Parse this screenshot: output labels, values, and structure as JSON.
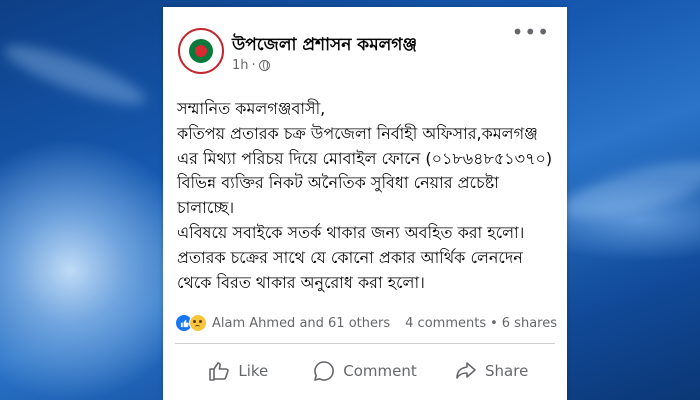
{
  "post": {
    "page_name": "উপজেলা প্রশাসন কমলগঞ্জ",
    "time": "1h",
    "visibility_icon": "globe-icon",
    "more_icon": "more-options-icon",
    "text": "সম্মানিত কমলগঞ্জবাসী,\nকতিপয় প্রতারক চক্র উপজেলা নির্বাহী অফিসার,কমলগঞ্জ এর মিথ্যা পরিচয় দিয়ে মোবাইল ফোনে (০১৮৬৪৮৫১৩৭০) বিভিন্ন ব্যক্তির নিকট অনৈতিক সুবিধা নেয়ার প্রচেষ্টা চালাচ্ছে।\nএবিষয়ে সবাইকে সতর্ক থাকার জন্য অবহিত করা হলো।প্রতারক চক্রের সাথে যে কোনো প্রকার আর্থিক লেনদেন থেকে বিরত থাকার অনুরোধ করা হলো।"
  },
  "engagement": {
    "reaction_icons": [
      "like-icon",
      "sad-icon"
    ],
    "reactors": "Alam Ahmed and 61 others",
    "comments": "4 comments",
    "separator": "•",
    "shares": "6 shares"
  },
  "actions": {
    "like": "Like",
    "comment": "Comment",
    "share": "Share"
  },
  "colors": {
    "accent": "#1877f2",
    "text": "#050505",
    "secondary_text": "#65676b"
  }
}
